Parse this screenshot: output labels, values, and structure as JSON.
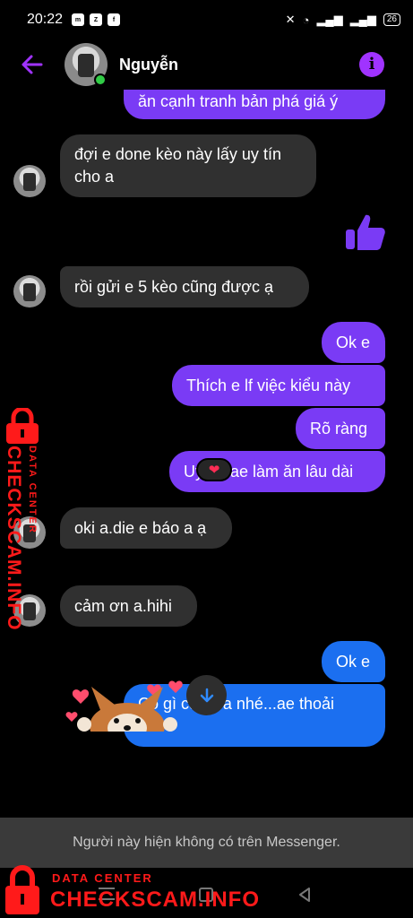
{
  "status_bar": {
    "time": "20:22",
    "battery": "26"
  },
  "header": {
    "contact_name": "Nguyễn"
  },
  "messages": {
    "m0": "ăn cạnh tranh bản phá giá ý",
    "m1_line1": "đợi e done kèo này lấy uy tín",
    "m1_line2": "cho a",
    "m2": "rồi gửi e 5 kèo cũng được ạ",
    "m3": "Ok e",
    "m4": "Thích e lf việc kiểu này",
    "m5": "Rõ ràng",
    "m6": "Uy tín ae làm ăn lâu dài",
    "m7": "oki a.die e báo a ạ",
    "m8": "cảm ơn a.hihi",
    "m9": "Ok e",
    "m10_line1": "Có gì cứ ới a nhé...ae thoải",
    "m10_line2": "mái"
  },
  "reaction": "❤",
  "notice": "Người này hiện không có trên Messenger.",
  "watermark": {
    "small": "DATA CENTER",
    "big": "CHECKSCAM.INFO"
  },
  "colors": {
    "sent_purple": "#7a3bf5",
    "sent_blue": "#1b6ff0",
    "received": "#303030",
    "accent": "#a033ff",
    "watermark_red": "#ff1a1a"
  }
}
